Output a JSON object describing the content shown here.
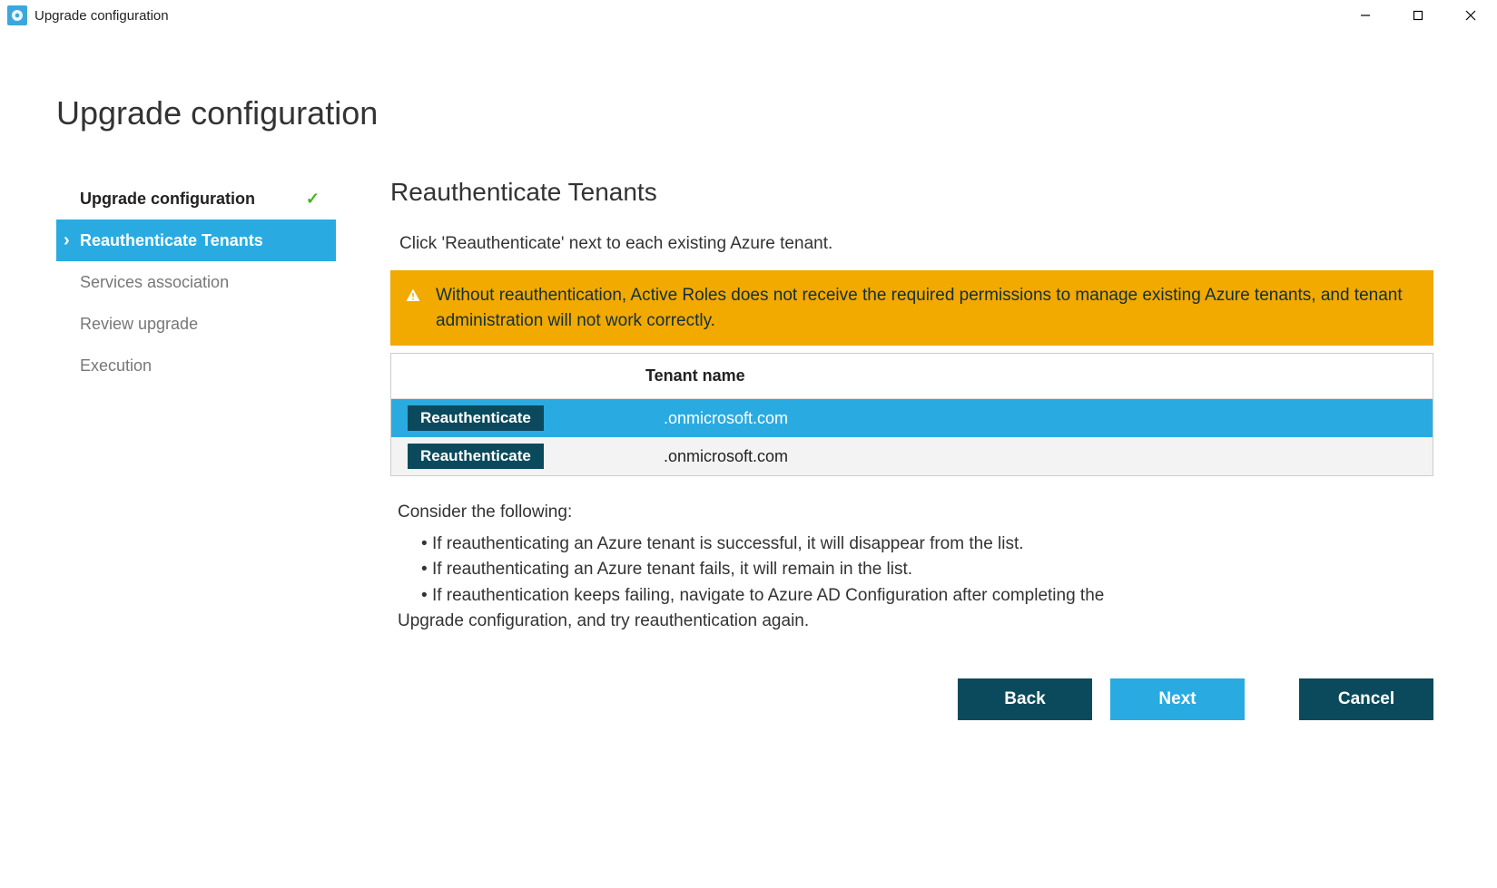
{
  "window": {
    "title": "Upgrade configuration"
  },
  "page": {
    "title": "Upgrade configuration"
  },
  "nav": {
    "items": [
      {
        "label": "Upgrade configuration",
        "state": "completed"
      },
      {
        "label": "Reauthenticate Tenants",
        "state": "active"
      },
      {
        "label": "Services association",
        "state": "pending"
      },
      {
        "label": "Review upgrade",
        "state": "pending"
      },
      {
        "label": "Execution",
        "state": "pending"
      }
    ]
  },
  "main": {
    "section_title": "Reauthenticate Tenants",
    "instruction": "Click 'Reauthenticate' next to each existing Azure tenant.",
    "warning": "Without reauthentication, Active Roles does not receive the required permissions to manage existing Azure tenants, and tenant administration will not work correctly.",
    "table": {
      "header_action": "",
      "header_name": "Tenant name",
      "rows": [
        {
          "action_label": "Reauthenticate",
          "name": ".onmicrosoft.com",
          "selected": true
        },
        {
          "action_label": "Reauthenticate",
          "name": ".onmicrosoft.com",
          "selected": false
        }
      ]
    },
    "consider": {
      "heading": "Consider the following:",
      "bullets": [
        "If reauthenticating an Azure tenant is successful, it will disappear from the list.",
        "If reauthenticating an Azure tenant fails, it will remain in the list.",
        "If reauthentication keeps failing, navigate to Azure AD Configuration after completing the"
      ],
      "trail": "Upgrade configuration, and try reauthentication again."
    }
  },
  "buttons": {
    "back": "Back",
    "next": "Next",
    "cancel": "Cancel"
  }
}
